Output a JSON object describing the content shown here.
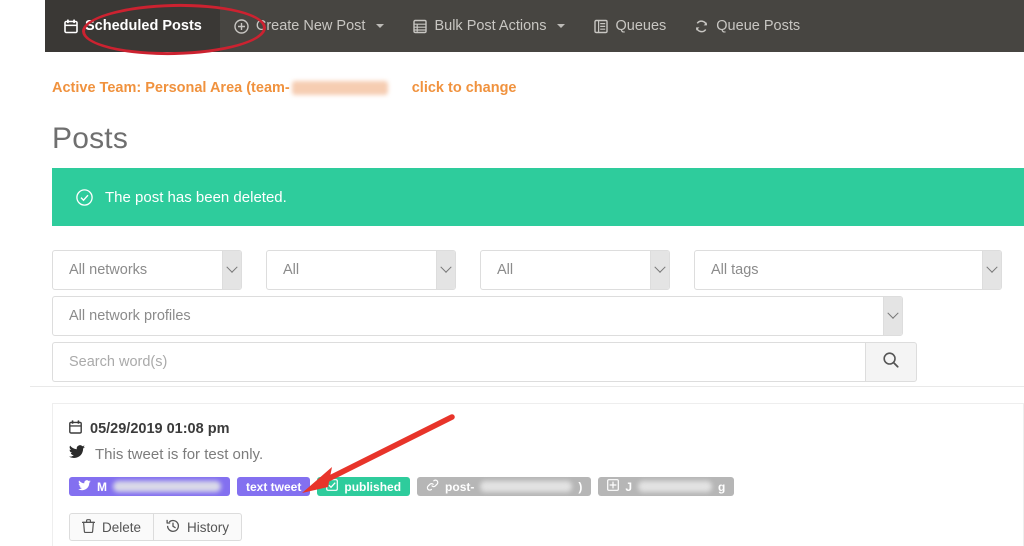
{
  "navbar": {
    "items": [
      {
        "label": "Scheduled Posts",
        "icon": "calendar-icon",
        "active": true,
        "caret": false
      },
      {
        "label": "Create New Post",
        "icon": "plus-circle-icon",
        "active": false,
        "caret": true
      },
      {
        "label": "Bulk Post Actions",
        "icon": "list-rows-icon",
        "active": false,
        "caret": true
      },
      {
        "label": "Queues",
        "icon": "queue-list-icon",
        "active": false,
        "caret": false
      },
      {
        "label": "Queue Posts",
        "icon": "refresh-cycle-icon",
        "active": false,
        "caret": false
      }
    ]
  },
  "team": {
    "prefix": "Active Team: Personal Area (team-",
    "redacted": "",
    "change_label": "click to change",
    "color": "#f0923e"
  },
  "page": {
    "title": "Posts"
  },
  "alert": {
    "message": "The post has been deleted.",
    "icon": "check-circle-icon",
    "color": "#2ecc9c"
  },
  "filters": {
    "network": {
      "value": "All networks"
    },
    "status": {
      "value": "All"
    },
    "type": {
      "value": "All"
    },
    "tags": {
      "value": "All tags"
    },
    "profiles": {
      "value": "All network profiles"
    },
    "search": {
      "value": "",
      "placeholder": "Search word(s)",
      "button_icon": "search-icon"
    }
  },
  "post": {
    "date": "05/29/2019 01:08 pm",
    "date_icon": "calendar-icon",
    "text": "This tweet is for test only.",
    "text_icon": "twitter-bird-icon",
    "badges": [
      {
        "name": "network-account-badge",
        "icon": "twitter-bird-icon",
        "label": "M",
        "redacted": true,
        "color": "#8370f0",
        "style": "purple"
      },
      {
        "name": "post-type-badge",
        "icon": "",
        "label": "text tweet",
        "redacted": false,
        "color": "#8370f0",
        "style": "purple"
      },
      {
        "name": "status-badge",
        "icon": "checkbox-icon",
        "label": "published",
        "redacted": false,
        "color": "#2ecc9c",
        "style": "green"
      },
      {
        "name": "post-id-badge",
        "icon": "link-icon",
        "label": "post-",
        "suffix": ")",
        "redacted": true,
        "color": "#b6b6b6",
        "style": "gray"
      },
      {
        "name": "queue-badge",
        "icon": "grid-plus-icon",
        "label": "J",
        "suffix": "g",
        "redacted": true,
        "color": "#b6b6b6",
        "style": "gray"
      }
    ],
    "actions": [
      {
        "label": "Delete",
        "icon": "trash-icon"
      },
      {
        "label": "History",
        "icon": "history-clock-icon"
      }
    ]
  },
  "annotations": {
    "highlight_ellipse_target": "Scheduled Posts",
    "arrow_color": "#e8342a",
    "arrow_points_to": "published"
  }
}
